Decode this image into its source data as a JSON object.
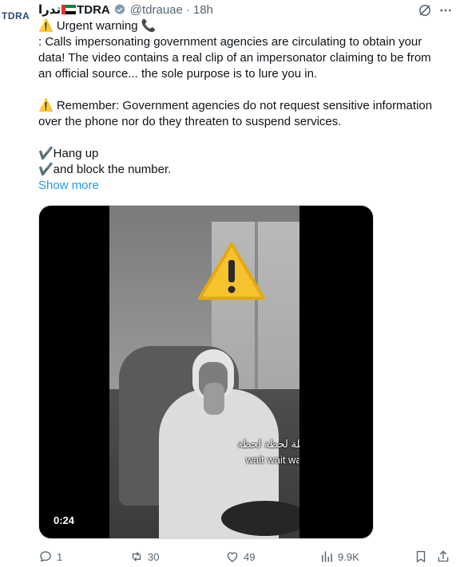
{
  "avatar": {
    "text": "TDRA"
  },
  "header": {
    "name_ar": "تدرا",
    "name_en": "TDRA",
    "handle": "@tdrauae",
    "separator": "·",
    "time": "18h"
  },
  "post": {
    "lines": [
      "⚠️ Urgent warning 📞",
      ": Calls impersonating government agencies are circulating to obtain your",
      "data! The video contains a real clip of an impersonator claiming to be from",
      "an official source... the sole purpose is to lure you in.",
      "",
      "⚠️ Remember: Government agencies do not request sensitive information",
      "over the phone nor do they threaten to suspend services.",
      "",
      "✔️Hang up",
      "✔️and block the number."
    ],
    "show_more": "Show more"
  },
  "media": {
    "caption_ar": "لحظة لحظة لحظة..",
    "caption_en": "wait wait wait..",
    "duration": "0:24"
  },
  "actions": {
    "replies": "1",
    "reposts": "30",
    "likes": "49",
    "views": "9.9K"
  },
  "colors": {
    "accent": "#1d9bf0",
    "muted": "#536471",
    "text": "#0f1419"
  }
}
